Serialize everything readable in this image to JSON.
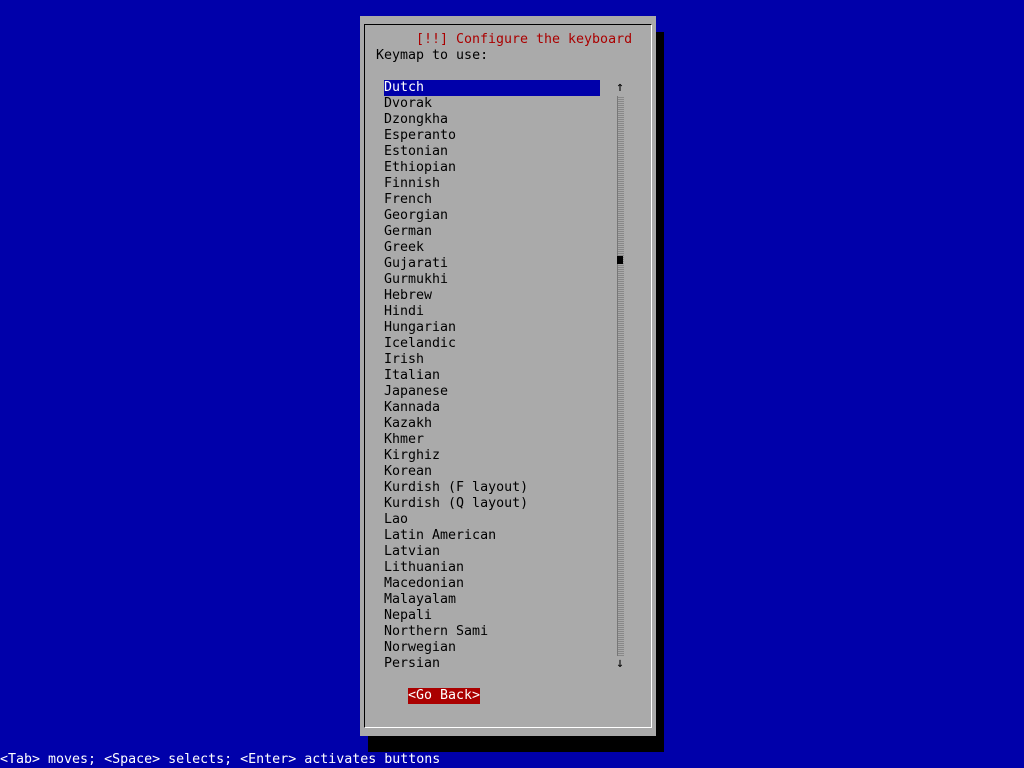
{
  "dialog": {
    "title": "[!!] Configure the keyboard",
    "prompt": "Keymap to use:",
    "selected_index": 0,
    "items": [
      "Dutch",
      "Dvorak",
      "Dzongkha",
      "Esperanto",
      "Estonian",
      "Ethiopian",
      "Finnish",
      "French",
      "Georgian",
      "German",
      "Greek",
      "Gujarati",
      "Gurmukhi",
      "Hebrew",
      "Hindi",
      "Hungarian",
      "Icelandic",
      "Irish",
      "Italian",
      "Japanese",
      "Kannada",
      "Kazakh",
      "Khmer",
      "Kirghiz",
      "Korean",
      "Kurdish (F layout)",
      "Kurdish (Q layout)",
      "Lao",
      "Latin American",
      "Latvian",
      "Lithuanian",
      "Macedonian",
      "Malayalam",
      "Nepali",
      "Northern Sami",
      "Norwegian",
      "Persian"
    ],
    "scroll_position": 0.29,
    "scroll_up_glyph": "↑",
    "scroll_down_glyph": "↓",
    "go_back_label": "<Go Back>"
  },
  "status_line": "<Tab> moves; <Space> selects; <Enter> activates buttons",
  "colors": {
    "background": "#0000aa",
    "dialog": "#aaaaaa",
    "title": "#aa0000",
    "selection": "#0000aa",
    "button": "#aa0000"
  }
}
